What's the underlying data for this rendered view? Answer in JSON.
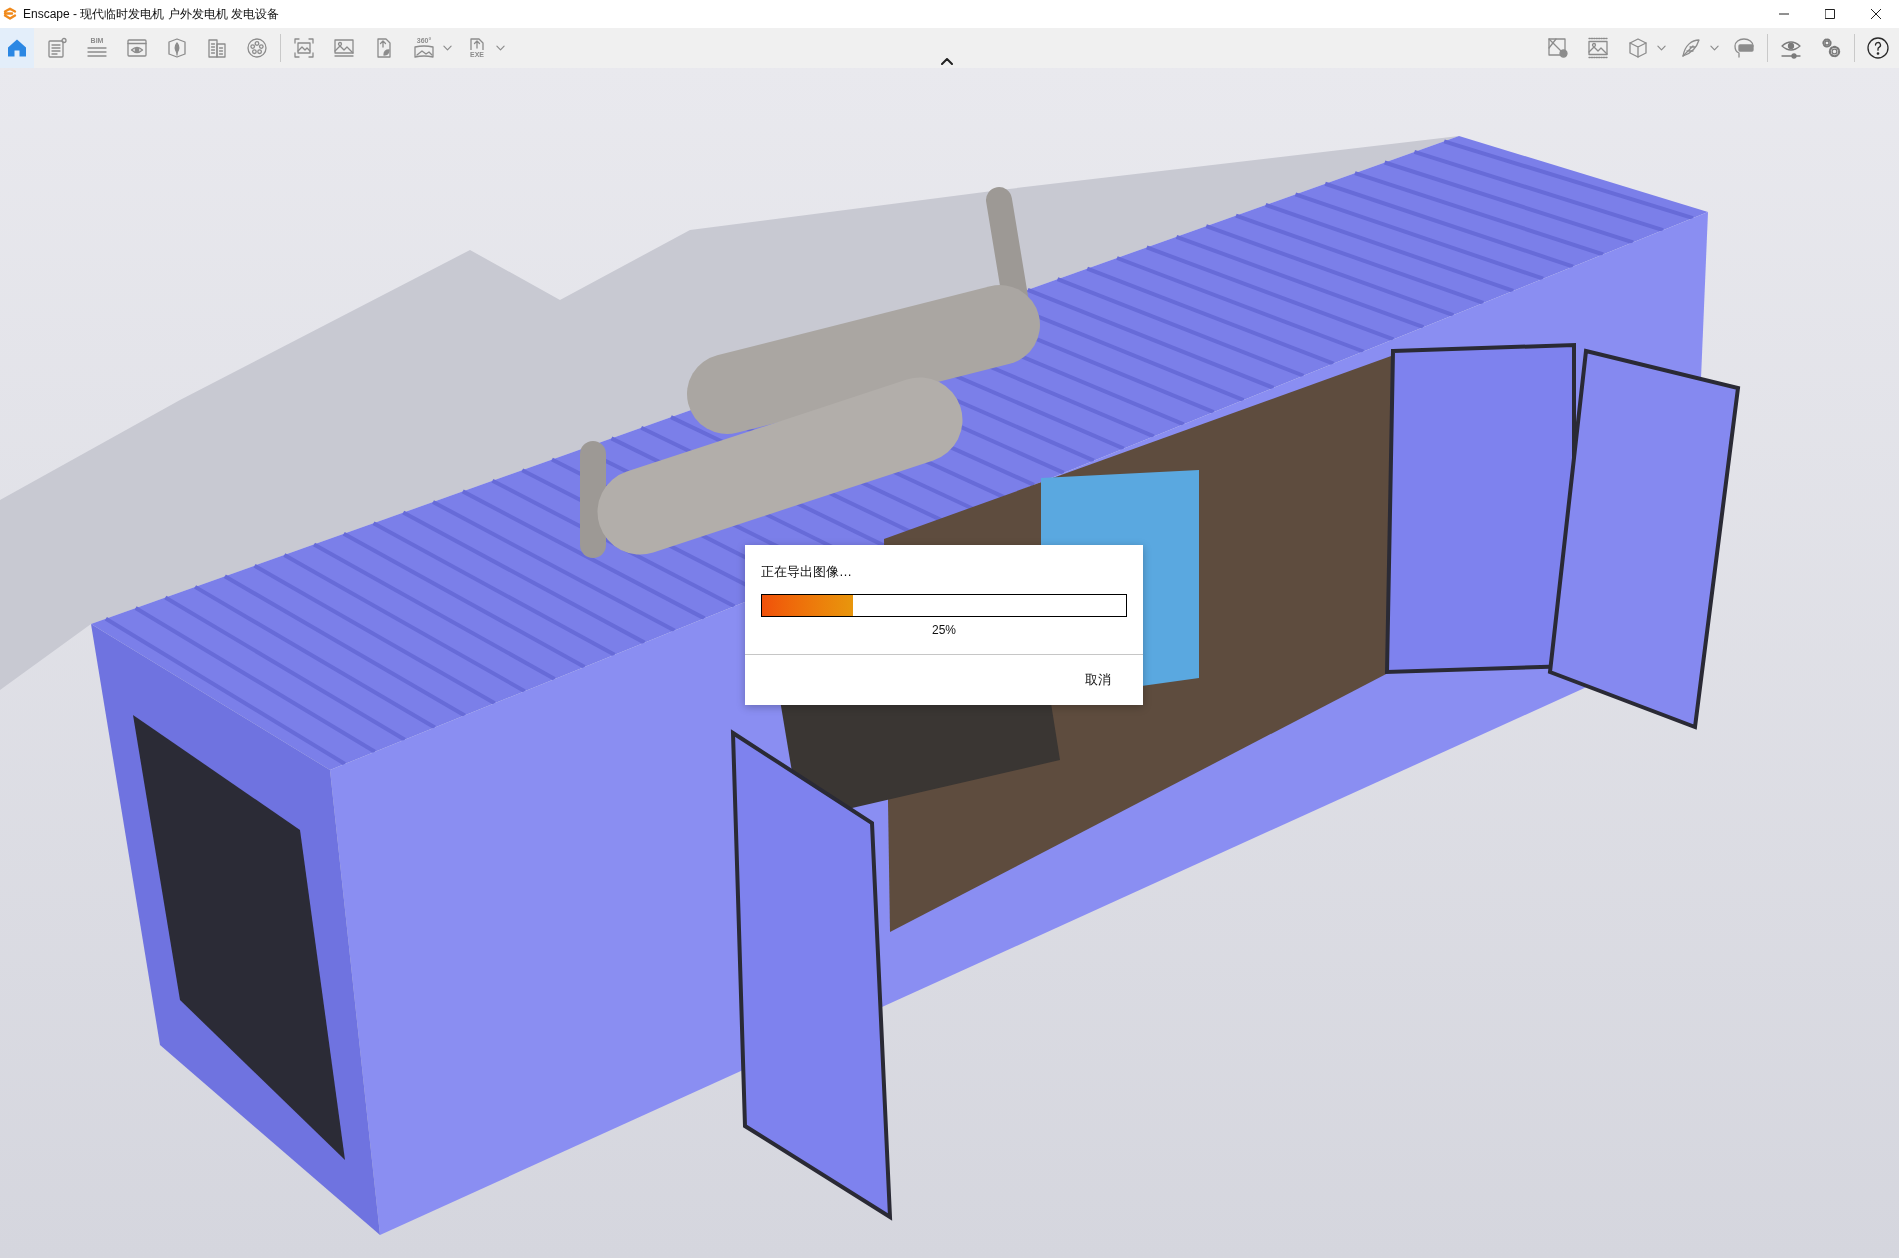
{
  "window": {
    "title": "Enscape - 现代临时发电机 户外发电机 发电设备"
  },
  "toolbar": {
    "left_groups": [
      [
        {
          "selected": true,
          "menu": false
        },
        {
          "selected": false,
          "menu": false
        },
        {
          "selected": false,
          "menu": false,
          "label": "BIM"
        },
        {
          "selected": false,
          "menu": false
        },
        {
          "selected": false,
          "menu": false
        },
        {
          "selected": false,
          "menu": false
        },
        {
          "selected": false,
          "menu": false
        }
      ],
      [
        {
          "selected": false,
          "menu": false
        },
        {
          "selected": false,
          "menu": false
        },
        {
          "selected": false,
          "menu": false
        },
        {
          "selected": false,
          "menu": true,
          "label": "360°"
        },
        {
          "selected": false,
          "menu": true,
          "label": "EXE"
        }
      ]
    ],
    "right_groups": [
      [
        {
          "selected": false,
          "menu": false
        },
        {
          "selected": false,
          "menu": false
        },
        {
          "selected": false,
          "menu": true
        },
        {
          "selected": false,
          "menu": true
        },
        {
          "selected": false,
          "menu": false
        }
      ],
      [
        {
          "selected": false,
          "menu": false
        },
        {
          "selected": false,
          "menu": false
        }
      ],
      [
        {
          "selected": false,
          "menu": false
        }
      ]
    ]
  },
  "dialog": {
    "message": "正在导出图像…",
    "progress": {
      "level": 0.25,
      "reading": "25%"
    },
    "buttons": [
      "取消"
    ]
  }
}
